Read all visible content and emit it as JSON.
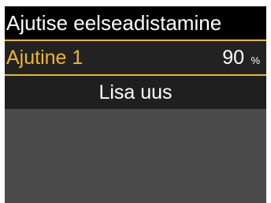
{
  "header": {
    "title": "Ajutise eelseadistamine"
  },
  "list": {
    "items": [
      {
        "label": "Ajutine 1",
        "value": "90",
        "unit": "%"
      }
    ],
    "add_label": "Lisa uus"
  },
  "colors": {
    "title_bg": "#000000",
    "screen_bg": "#4b4b4b",
    "row_bg": "#222222",
    "selection_accent": "#e8b830",
    "selected_label": "#f1b52a",
    "text": "#ffffff"
  }
}
